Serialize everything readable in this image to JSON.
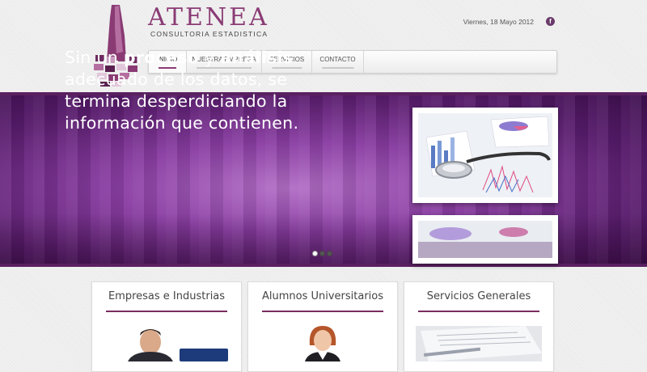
{
  "header": {
    "logo_name": "ATENEA",
    "logo_subtitle": "CONSULTORIA ESTADISTICA",
    "date": "Viernes, 18 Mayo 2012",
    "social_icon": "facebook-icon"
  },
  "nav": {
    "items": [
      {
        "label": "INICIO",
        "active": true
      },
      {
        "label": "NUESTRA EMPRESA",
        "active": false
      },
      {
        "label": "SERVICIOS",
        "active": false
      },
      {
        "label": "CONTACTO",
        "active": false
      }
    ]
  },
  "banner": {
    "line1_a": "Sin un ",
    "line1_b": "proceso",
    "line1_c": " y ",
    "line1_d": "análisis",
    "line2": "adecuado de los datos, se",
    "line3": "termina desperdiciando la",
    "line4": "información que contienen.",
    "slides_total": 3,
    "active_slide": 1
  },
  "cards": [
    {
      "title": "Empresas e Industrias"
    },
    {
      "title": "Alumnos Universitarios"
    },
    {
      "title": "Servicios Generales"
    }
  ],
  "colors": {
    "brand": "#8a3b74",
    "banner": "#7a3491",
    "rule": "#7a2d5f"
  }
}
